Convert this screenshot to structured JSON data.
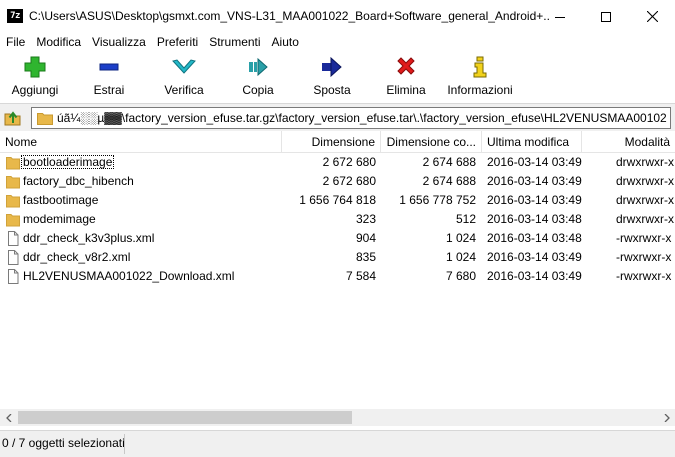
{
  "window": {
    "app_icon_text": "7z",
    "title": "C:\\Users\\ASUS\\Desktop\\gsmxt.com_VNS-L31_MAA001022_Board+Software_general_Android+..."
  },
  "menu": [
    "File",
    "Modifica",
    "Visualizza",
    "Preferiti",
    "Strumenti",
    "Aiuto"
  ],
  "toolbar": {
    "add": "Aggiungi",
    "extract": "Estrai",
    "test": "Verifica",
    "copy": "Copia",
    "move": "Sposta",
    "delete": "Elimina",
    "info": "Informazioni"
  },
  "address": {
    "path": "úã¼░░µ▓▓\\factory_version_efuse.tar.gz\\factory_version_efuse.tar\\.\\factory_version_efuse\\HL2VENUSMAA001022\\"
  },
  "columns": [
    "Nome",
    "Dimensione",
    "Dimensione co...",
    "Ultima modifica",
    "Modalità"
  ],
  "files": [
    {
      "name": "bootloaderimage",
      "type": "folder",
      "size": "2 672 680",
      "packed": "2 674 688",
      "modified": "2016-03-14 03:49",
      "mode": "drwxrwxr-x"
    },
    {
      "name": "factory_dbc_hibench",
      "type": "folder",
      "size": "2 672 680",
      "packed": "2 674 688",
      "modified": "2016-03-14 03:49",
      "mode": "drwxrwxr-x"
    },
    {
      "name": "fastbootimage",
      "type": "folder",
      "size": "1 656 764 818",
      "packed": "1 656 778 752",
      "modified": "2016-03-14 03:49",
      "mode": "drwxrwxr-x"
    },
    {
      "name": "modemimage",
      "type": "folder",
      "size": "323",
      "packed": "512",
      "modified": "2016-03-14 03:48",
      "mode": "drwxrwxr-x"
    },
    {
      "name": "ddr_check_k3v3plus.xml",
      "type": "file",
      "size": "904",
      "packed": "1 024",
      "modified": "2016-03-14 03:48",
      "mode": "-rwxrwxr-x"
    },
    {
      "name": "ddr_check_v8r2.xml",
      "type": "file",
      "size": "835",
      "packed": "1 024",
      "modified": "2016-03-14 03:49",
      "mode": "-rwxrwxr-x"
    },
    {
      "name": "HL2VENUSMAA001022_Download.xml",
      "type": "file",
      "size": "7 584",
      "packed": "7 680",
      "modified": "2016-03-14 03:49",
      "mode": "-rwxrwxr-x"
    }
  ],
  "status": {
    "selection": "0 / 7 oggetti selezionati"
  },
  "colors": {
    "folder": "#e8b84a",
    "add_green": "#2fb52f",
    "extract_blue": "#1c3fc8",
    "test_cyan": "#23b8c8",
    "delete_red": "#e01b1b",
    "info_yellow": "#f2d21c"
  }
}
